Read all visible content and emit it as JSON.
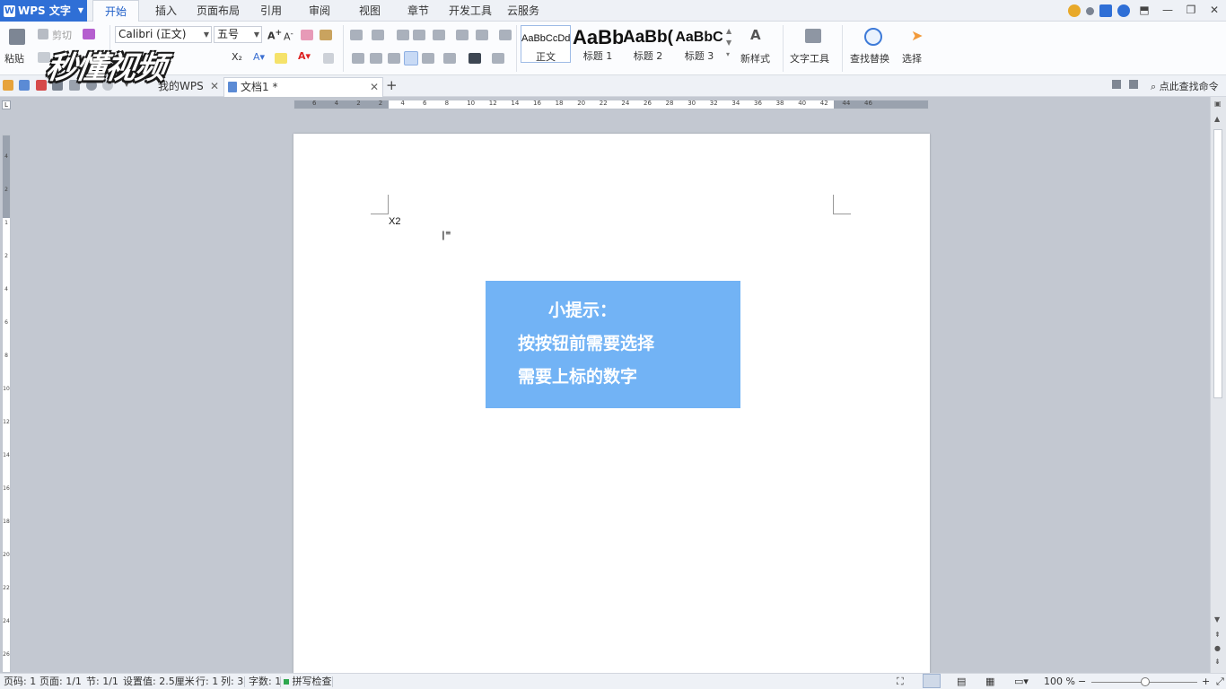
{
  "app": {
    "name": "WPS 文字"
  },
  "menu_tabs": [
    "开始",
    "插入",
    "页面布局",
    "引用",
    "审阅",
    "视图",
    "章节",
    "开发工具",
    "云服务"
  ],
  "active_menu_tab": "开始",
  "ribbon": {
    "paste_label": "粘贴",
    "cut_label": "剪切",
    "font_name": "Calibri (正文)",
    "font_size": "五号",
    "styles": [
      {
        "preview": "AaBbCcDd",
        "label": "正文"
      },
      {
        "preview": "AaBb",
        "label": "标题 1"
      },
      {
        "preview": "AaBb(",
        "label": "标题 2"
      },
      {
        "preview": "AaBbC",
        "label": "标题 3"
      }
    ],
    "new_style_label": "新样式",
    "text_tools_label": "文字工具",
    "find_replace_label": "查找替换",
    "select_label": "选择"
  },
  "doc_tabs": [
    {
      "label": "我的WPS",
      "active": false
    },
    {
      "label": "文档1 *",
      "active": true
    }
  ],
  "search_command": "点此查找命令",
  "ruler": {
    "h_ticks": [
      "6",
      "4",
      "2",
      "2",
      "4",
      "6",
      "8",
      "10",
      "12",
      "14",
      "16",
      "18",
      "20",
      "22",
      "24",
      "26",
      "28",
      "30",
      "32",
      "34",
      "36",
      "38",
      "40",
      "42",
      "44",
      "46"
    ],
    "v_ticks": [
      "4",
      "2",
      "1",
      "2",
      "4",
      "6",
      "8",
      "10",
      "12",
      "14",
      "16",
      "18",
      "20",
      "22",
      "24",
      "26"
    ]
  },
  "document": {
    "body_text": "X2",
    "tip_lines": [
      "小提示：",
      "按按钮前需要选择",
      "需要上标的数字"
    ],
    "tip_color": "#72b3f5"
  },
  "status": {
    "page_code": "页码: 1",
    "pages": "页面: 1/1",
    "section": "节: 1/1",
    "setting": "设置值: 2.5厘米",
    "row": "行: 1",
    "col": "列: 3",
    "word_count": "字数: 1",
    "spell_check": "拼写检查",
    "zoom": "100 %"
  },
  "watermark": "秒懂视频",
  "colors": {
    "accent": "#2f6fd6",
    "tip_bg": "#72b3f5",
    "page": "#ffffff"
  }
}
